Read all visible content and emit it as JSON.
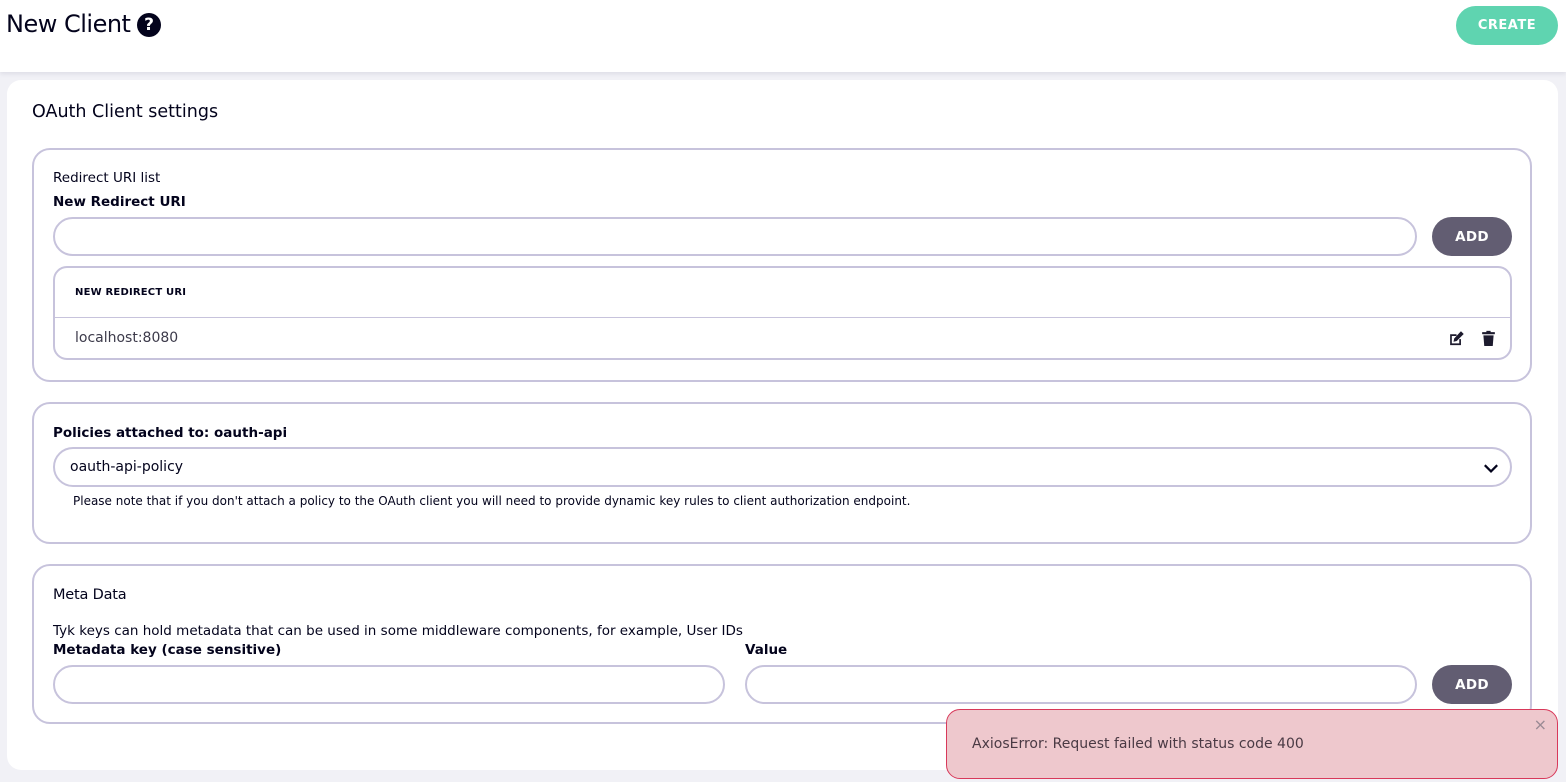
{
  "header": {
    "title": "New Client",
    "help_icon": "question-circle",
    "create_label": "CREATE"
  },
  "colors": {
    "create_button": "#5fd4b0",
    "add_button": "#625d72",
    "border": "#c7c3dc",
    "error_bg": "#eec8cd",
    "error_border": "#d8395a"
  },
  "card": {
    "title": "OAuth Client settings"
  },
  "redirect": {
    "section_label": "Redirect URI list",
    "input_label": "New Redirect URI",
    "input_value": "",
    "add_label": "ADD",
    "table_header": "NEW REDIRECT URI",
    "rows": [
      {
        "value": "localhost:8080",
        "edit_icon": "edit",
        "delete_icon": "trash"
      }
    ]
  },
  "policies": {
    "label": "Policies attached to: oauth-api",
    "selected": "oauth-api-policy",
    "note": "Please note that if you don't attach a policy to the OAuth client you will need to provide dynamic key rules to client authorization endpoint."
  },
  "metadata": {
    "title": "Meta Data",
    "description": "Tyk keys can hold metadata that can be used in some middleware components, for example, User IDs",
    "key_label": "Metadata key (case sensitive)",
    "key_value": "",
    "value_label": "Value",
    "value_value": "",
    "add_label": "ADD"
  },
  "toast": {
    "message": "AxiosError: Request failed with status code 400",
    "close": "×"
  }
}
